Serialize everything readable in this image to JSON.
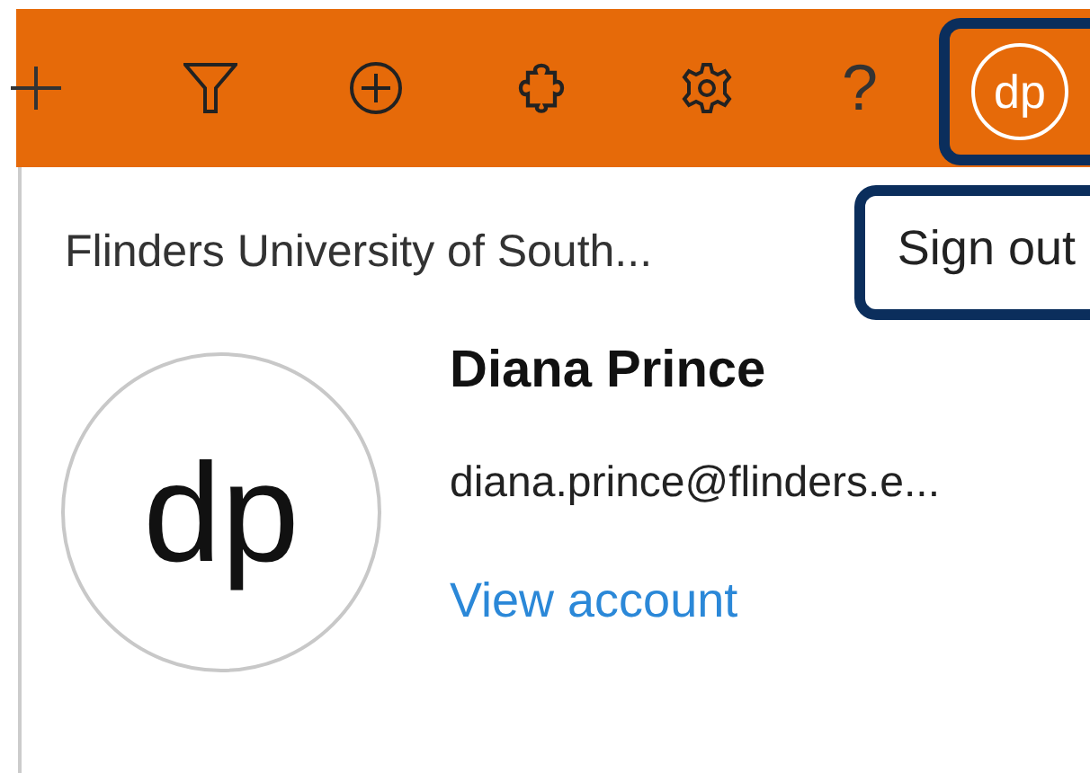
{
  "toolbar": {
    "buttons": [
      {
        "kind": "add"
      },
      {
        "kind": "filter"
      },
      {
        "kind": "add-circle"
      },
      {
        "kind": "puzzle"
      },
      {
        "kind": "settings"
      },
      {
        "kind": "help",
        "text": "?"
      }
    ],
    "avatar": {
      "initials": "dp",
      "highlighted": true
    }
  },
  "account_panel": {
    "organization": "Flinders University of South...",
    "sign_out": {
      "label": "Sign out",
      "highlighted": true
    },
    "avatar_initials": "dp",
    "name": "Diana Prince",
    "email": "diana.prince@flinders.e...",
    "view_account": "View account"
  }
}
